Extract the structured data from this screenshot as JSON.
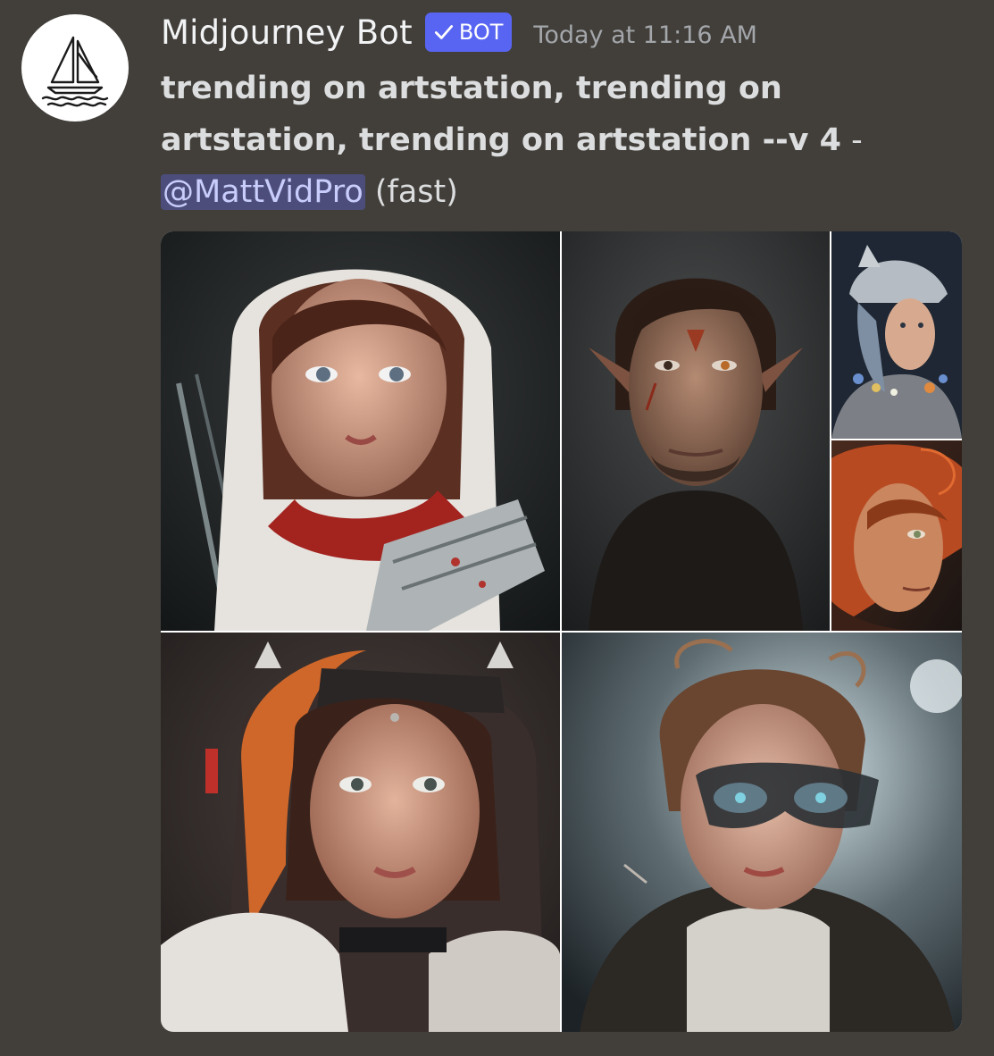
{
  "message": {
    "author": "Midjourney Bot",
    "bot_tag": "BOT",
    "timestamp": "Today at 11:16 AM",
    "prompt": "trending on artstation, trending on artstation, trending on artstation --v 4",
    "separator": " - ",
    "mention": "@MattVidPro",
    "mode": " (fast)"
  },
  "icons": {
    "avatar": "sailboat-logo",
    "verified": "checkmark-icon"
  },
  "images": [
    {
      "name": "hooded-girl-red-scarf"
    },
    {
      "name": "scarred-man-portrait"
    },
    {
      "name": "helmeted-woman-flowers"
    },
    {
      "name": "redhead-woman-profile"
    },
    {
      "name": "hooded-girl-orange-hood"
    },
    {
      "name": "girl-with-goggles"
    }
  ],
  "colors": {
    "background": "#423f3a",
    "bot_tag": "#5865f2",
    "mention_bg": "#4c4d7a",
    "mention_text": "#c9cdfb",
    "timestamp": "#a3a6aa"
  }
}
